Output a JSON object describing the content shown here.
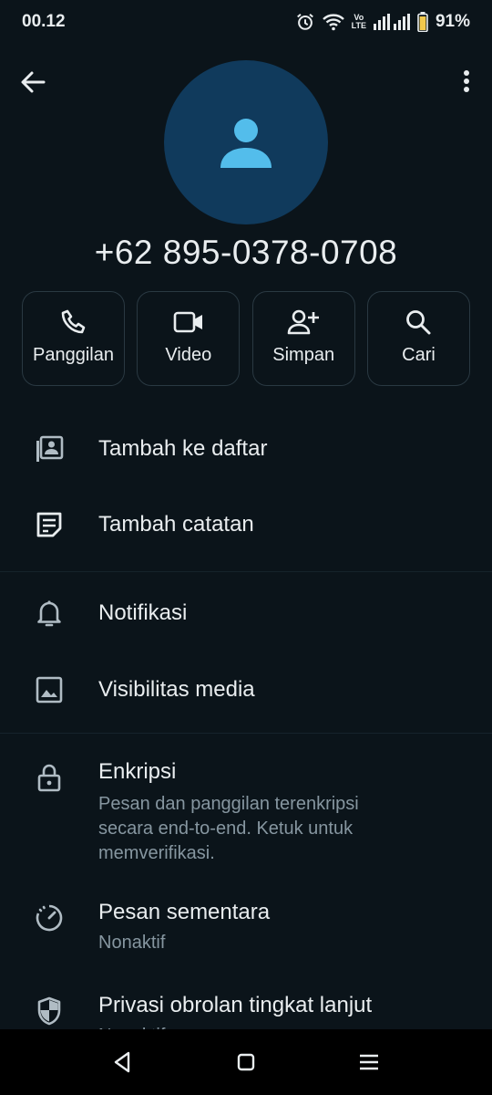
{
  "status": {
    "time": "00.12",
    "battery": "91%",
    "volte_top": "Vo",
    "volte_bottom": "LTE"
  },
  "contact": {
    "phone": "+62 895-0378-0708"
  },
  "actions": [
    {
      "label": "Panggilan",
      "icon": "phone-icon"
    },
    {
      "label": "Video",
      "icon": "video-icon"
    },
    {
      "label": "Simpan",
      "icon": "add-person-icon"
    },
    {
      "label": "Cari",
      "icon": "search-icon"
    }
  ],
  "menu": {
    "add_to_list": "Tambah ke daftar",
    "add_note": "Tambah catatan",
    "notifications": "Notifikasi",
    "media_visibility": "Visibilitas media",
    "encryption": {
      "title": "Enkripsi",
      "subtitle": "Pesan dan panggilan terenkripsi secara end-to-end. Ketuk untuk memverifikasi."
    },
    "disappearing": {
      "title": "Pesan sementara",
      "subtitle": "Nonaktif"
    },
    "advanced_privacy": {
      "title": "Privasi obrolan tingkat lanjut",
      "subtitle": "Nonaktif"
    }
  },
  "colors": {
    "background": "#0b141a",
    "avatar_bg": "#103a5c",
    "avatar_icon": "#53bdeb",
    "muted": "#8696a0"
  }
}
